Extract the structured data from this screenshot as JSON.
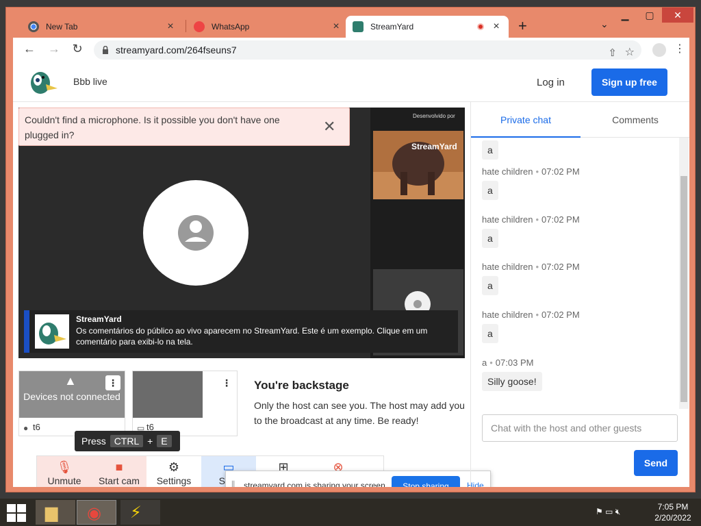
{
  "browser": {
    "tabs": [
      {
        "label": "New Tab"
      },
      {
        "label": "WhatsApp"
      },
      {
        "label": "StreamYard"
      }
    ],
    "new_tab_symbol": "+",
    "url": "streamyard.com/264fseuns7"
  },
  "header": {
    "broadcast_title": "Bbb live",
    "login_label": "Log in",
    "signup_label": "Sign up free"
  },
  "alert": {
    "text": "Couldn't find a microphone. Is it possible you don't have one plugged in?",
    "close_symbol": "✕"
  },
  "stage": {
    "dev_label": "Desenvolvido por",
    "side_logo_text": "StreamYard",
    "banner": {
      "name": "StreamYard",
      "text": "Os comentários do público ao vivo aparecem no StreamYard. Este é um exemplo. Clique em um comentário para exibi-lo na tela."
    }
  },
  "participants": [
    {
      "status": "Devices not connected",
      "name": "t6"
    },
    {
      "name": "t6"
    }
  ],
  "backstage": {
    "title": "You're backstage",
    "text": "Only the host can see you. The host may add you to the broadcast at any time. Be ready!"
  },
  "controls": {
    "unmute": "Unmute",
    "start_cam": "Start cam",
    "settings": "Settings",
    "stop": "Stop"
  },
  "tooltip": {
    "press": "Press",
    "key1": "CTRL",
    "plus": "+",
    "key2": "E"
  },
  "share_bar": {
    "text": "streamyard.com is sharing your screen.",
    "stop_label": "Stop sharing",
    "hide_label": "Hide"
  },
  "chat": {
    "tabs": [
      "Private chat",
      "Comments"
    ],
    "messages": [
      {
        "author": "",
        "time": "",
        "text": "a"
      },
      {
        "author": "hate children",
        "time": "07:02 PM",
        "text": "a"
      },
      {
        "author": "hate children",
        "time": "07:02 PM",
        "text": "a"
      },
      {
        "author": "hate children",
        "time": "07:02 PM",
        "text": "a"
      },
      {
        "author": "hate children",
        "time": "07:02 PM",
        "text": "a"
      },
      {
        "author": "a",
        "time": "07:03 PM",
        "text": "Silly goose!"
      }
    ],
    "input_placeholder": "Chat with the host and other guests",
    "send_label": "Send"
  },
  "taskbar": {
    "time": "7:05 PM",
    "date": "2/20/2022"
  },
  "colors": {
    "brand_blue": "#1a6be8",
    "window_frame": "#e8896b",
    "alert_bg": "#fde9e7"
  },
  "icons": [
    "chrome-icon",
    "whatsapp-icon",
    "streamyard-icon",
    "lock-icon",
    "share-icon",
    "star-icon",
    "profile-icon",
    "menu-icon",
    "mic-off-icon",
    "cam-off-icon",
    "gear-icon",
    "screen-icon",
    "add-icon",
    "leave-icon",
    "windows-icon",
    "explorer-icon",
    "thunder-icon"
  ]
}
